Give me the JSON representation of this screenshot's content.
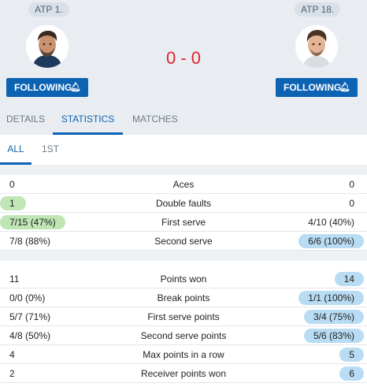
{
  "players": {
    "left": {
      "rank": "ATP 1.",
      "follow_label": "FOLLOWING",
      "bell": "bell-icon"
    },
    "right": {
      "rank": "ATP 18.",
      "follow_label": "FOLLOWING",
      "bell": "bell-icon"
    }
  },
  "score": "0 - 0",
  "tabs": [
    {
      "label": "DETAILS"
    },
    {
      "label": "STATISTICS",
      "active": true
    },
    {
      "label": "MATCHES"
    }
  ],
  "subtabs": [
    {
      "label": "ALL",
      "active": true
    },
    {
      "label": "1ST"
    }
  ],
  "colors": {
    "accent": "#0d63b3",
    "score": "#e4212b",
    "left_highlight": "#bfe6b4",
    "right_highlight": "#b8dcf3",
    "header_bg": "#e9edf2"
  },
  "stats": [
    {
      "label": "Aces",
      "left": "0",
      "right": "0",
      "better": ""
    },
    {
      "label": "Double faults",
      "left": "1",
      "right": "0",
      "better": "left"
    },
    {
      "label": "First serve",
      "left": "7/15 (47%)",
      "right": "4/10 (40%)",
      "better": "left"
    },
    {
      "label": "Second serve",
      "left": "7/8 (88%)",
      "right": "6/6 (100%)",
      "better": "right"
    },
    {
      "label": "Points won",
      "left": "11",
      "right": "14",
      "better": "right"
    },
    {
      "label": "Break points",
      "left": "0/0 (0%)",
      "right": "1/1 (100%)",
      "better": "right"
    },
    {
      "label": "First serve points",
      "left": "5/7 (71%)",
      "right": "3/4 (75%)",
      "better": "right"
    },
    {
      "label": "Second serve points",
      "left": "4/8 (50%)",
      "right": "5/6 (83%)",
      "better": "right"
    },
    {
      "label": "Max points in a row",
      "left": "4",
      "right": "5",
      "better": "right"
    },
    {
      "label": "Receiver points won",
      "left": "2",
      "right": "6",
      "better": "right"
    }
  ]
}
